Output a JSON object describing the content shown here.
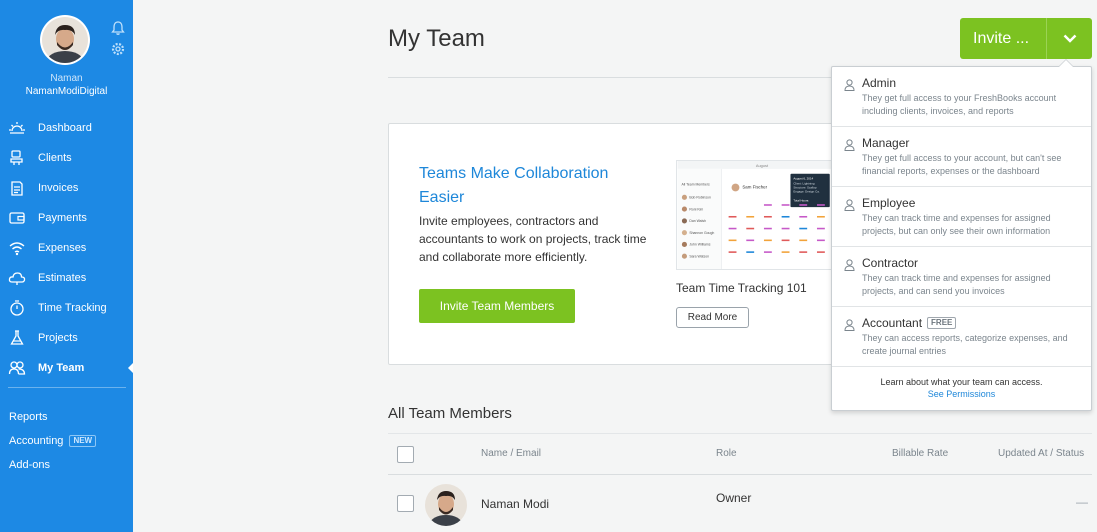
{
  "sidebar": {
    "user_name": "Naman",
    "user_org": "NamanModiDigital",
    "nav": [
      {
        "label": "Dashboard",
        "icon": "sun-icon"
      },
      {
        "label": "Clients",
        "icon": "clients-icon"
      },
      {
        "label": "Invoices",
        "icon": "invoice-icon"
      },
      {
        "label": "Payments",
        "icon": "wallet-icon"
      },
      {
        "label": "Expenses",
        "icon": "wifi-icon"
      },
      {
        "label": "Estimates",
        "icon": "cloud-icon"
      },
      {
        "label": "Time Tracking",
        "icon": "stopwatch-icon"
      },
      {
        "label": "Projects",
        "icon": "flask-icon"
      },
      {
        "label": "My Team",
        "icon": "team-icon",
        "active": true
      }
    ],
    "secondary": [
      {
        "label": "Reports"
      },
      {
        "label": "Accounting",
        "badge": "NEW"
      },
      {
        "label": "Add-ons"
      }
    ]
  },
  "header": {
    "title": "My Team",
    "invite_label": "Invite ..."
  },
  "promo": {
    "title": "Teams Make Collaboration Easier",
    "description": "Invite employees, contractors and accountants to work on projects, track time and collaborate more efficiently.",
    "button_label": "Invite Team Members",
    "video_title": "Team Time Tracking 101",
    "read_more_label": "Read More",
    "screenshot": {
      "month": "August",
      "person": "Sam Fischer",
      "popup": [
        "August 6, 2014",
        "Client: Lightning",
        "Structure: Scallop",
        "Engage: Design Ca."
      ],
      "popup_footer": "Total Hours:",
      "list": [
        "All Team Members",
        "Bob Robinson",
        "Roni Kim",
        "Dan Walsh",
        "Shannon Gough",
        "John Williams",
        "Sara Watson"
      ]
    }
  },
  "dropdown": {
    "roles": [
      {
        "name": "Admin",
        "description": "They get full access to your FreshBooks account including clients, invoices, and reports"
      },
      {
        "name": "Manager",
        "description": "They get full access to your account, but can't see financial reports, expenses or the dashboard"
      },
      {
        "name": "Employee",
        "description": "They can track time and expenses for assigned projects, but can only see their own information"
      },
      {
        "name": "Contractor",
        "description": "They can track time and expenses for assigned projects, and can send you invoices"
      },
      {
        "name": "Accountant",
        "badge": "FREE",
        "description": "They can access reports, categorize expenses, and create journal entries"
      }
    ],
    "footer_text": "Learn about what your team can access.",
    "footer_link": "See Permissions"
  },
  "members": {
    "title": "All Team Members",
    "columns": [
      "Name / Email",
      "Role",
      "Billable Rate",
      "Updated At / Status"
    ],
    "rows": [
      {
        "name": "Naman Modi",
        "role": "Owner",
        "billable_rate": "",
        "status": "—"
      }
    ]
  },
  "colors": {
    "sidebar": "#1d89e4",
    "accent_green": "#7cc221",
    "link_blue": "#1e87d9"
  }
}
